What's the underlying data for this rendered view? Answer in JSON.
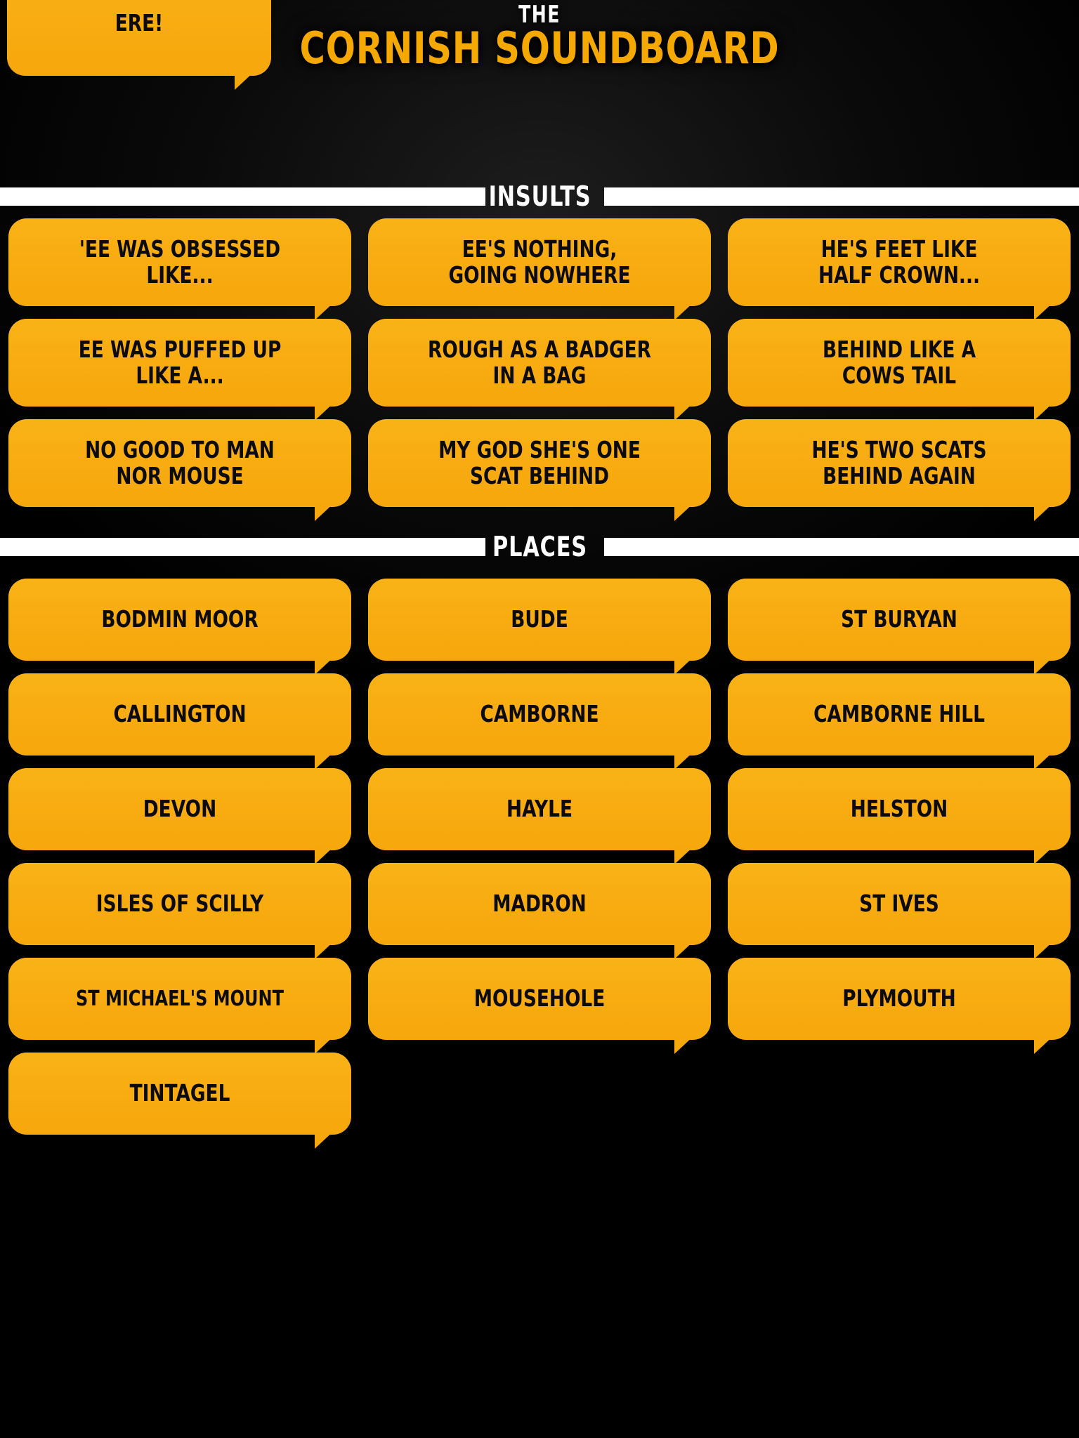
{
  "header": {
    "eyebrow": "THE",
    "title": "CORNISH SOUNDBOARD",
    "accent_color": "#f5a800",
    "eyebrow_color": "#ffffff",
    "background_color": "#000000"
  },
  "partial_top_button": {
    "label": "ERE!",
    "note": "clipped button at top-left, cut off by page top"
  },
  "sections": [
    {
      "id": "insults",
      "title": "INSULTS",
      "buttons": [
        "'EE WAS OBSESSED\nLIKE...",
        "EE'S NOTHING,\nGOING NOWHERE",
        "HE'S FEET LIKE\nHALF CROWN...",
        "EE WAS PUFFED UP\nLIKE A...",
        "ROUGH AS A BADGER\nIN A BAG",
        "BEHIND LIKE A\nCOWS TAIL",
        "NO GOOD TO MAN\nNOR MOUSE",
        "MY GOD SHE'S ONE\nSCAT BEHIND",
        "HE'S TWO SCATS\nBEHIND AGAIN"
      ]
    },
    {
      "id": "places",
      "title": "PLACES",
      "buttons": [
        "BODMIN MOOR",
        "BUDE",
        "ST BURYAN",
        "CALLINGTON",
        "CAMBORNE",
        "CAMBORNE HILL",
        "DEVON",
        "HAYLE",
        "HELSTON",
        "ISLES OF SCILLY",
        "MADRON",
        "ST IVES",
        "ST MICHAEL'S MOUNT",
        "MOUSEHOLE",
        "PLYMOUTH",
        "TINTAGEL"
      ]
    }
  ],
  "colors": {
    "bubble_orange": "#f8ad12",
    "bubble_text": "#0b0b0b",
    "divider_white": "#ffffff",
    "page_black": "#000000"
  }
}
